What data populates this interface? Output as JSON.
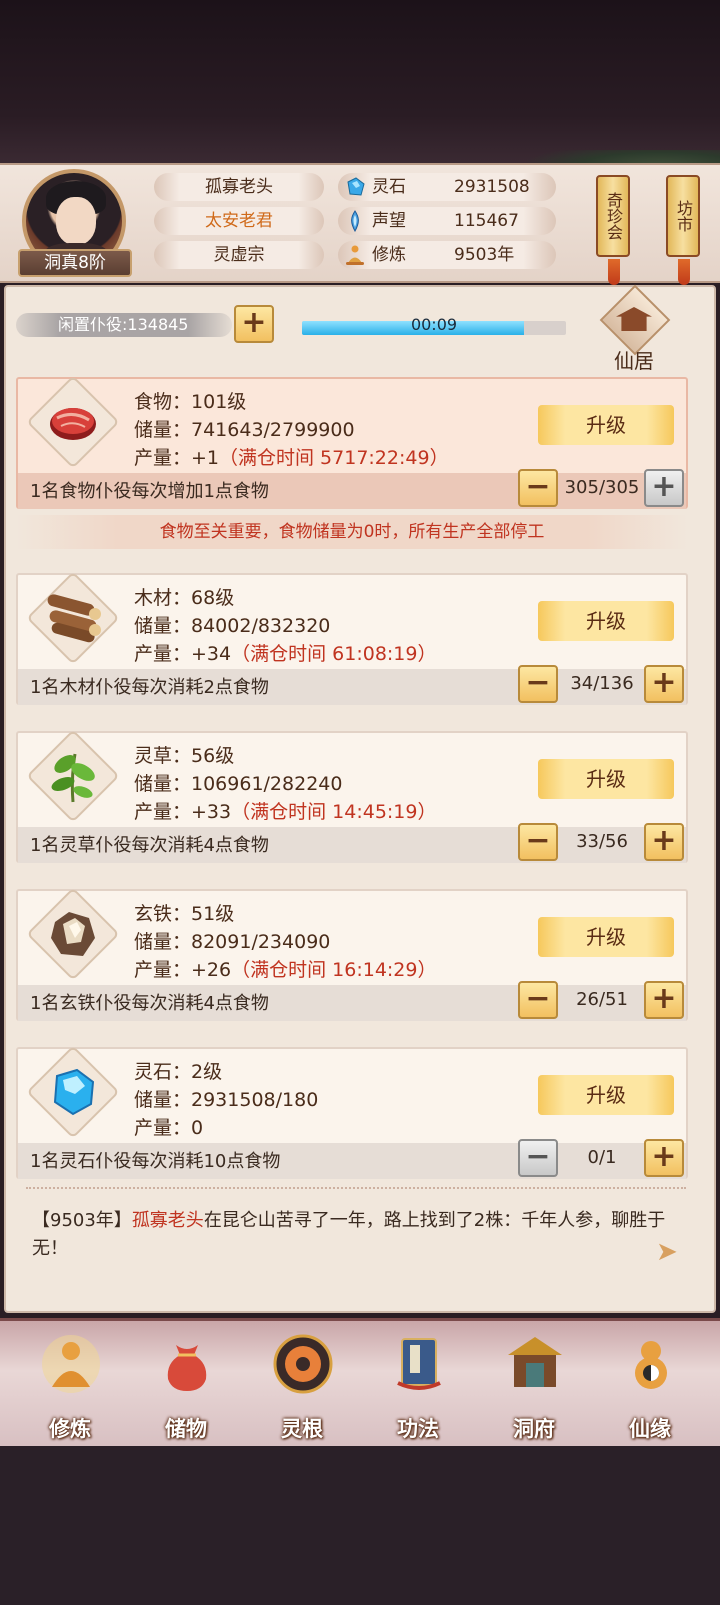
{
  "player": {
    "name": "孤寡老头",
    "title": "太安老君",
    "sect": "灵虚宗",
    "rank": "洞真8阶"
  },
  "stats": [
    {
      "icon": "spirit-stone-icon",
      "label": "灵石",
      "value": "2931508"
    },
    {
      "icon": "reputation-icon",
      "label": "声望",
      "value": "115467"
    },
    {
      "icon": "cultivation-icon",
      "label": "修炼",
      "value": "9503年"
    }
  ],
  "banners": {
    "treasure_label": "奇珍会",
    "market_label": "坊市"
  },
  "idle": {
    "label": "闲置仆役:",
    "count": "134845"
  },
  "timer": {
    "text": "00:09",
    "progress": 0.84
  },
  "residence_label": "仙居",
  "resources": [
    {
      "name": "食物",
      "level": "：101级",
      "storage": "储量：741643/2799900",
      "output": "产量：+1",
      "full": "（满仓时间 5717:22:49）",
      "desc": "1名食物仆役每次增加1点食物",
      "workers": "305/305",
      "upgrade": "升级",
      "icon": "meat-icon"
    },
    {
      "name": "木材",
      "level": "：68级",
      "storage": "储量：84002/832320",
      "output": "产量：+34",
      "full": "（满仓时间 61:08:19）",
      "desc": "1名木材仆役每次消耗2点食物",
      "workers": "34/136",
      "upgrade": "升级",
      "icon": "wood-icon"
    },
    {
      "name": "灵草",
      "level": "：56级",
      "storage": "储量：106961/282240",
      "output": "产量：+33",
      "full": "（满仓时间 14:45:19）",
      "desc": "1名灵草仆役每次消耗4点食物",
      "workers": "33/56",
      "upgrade": "升级",
      "icon": "herb-icon"
    },
    {
      "name": "玄铁",
      "level": "：51级",
      "storage": "储量：82091/234090",
      "output": "产量：+26",
      "full": "（满仓时间 16:14:29）",
      "desc": "1名玄铁仆役每次消耗4点食物",
      "workers": "26/51",
      "upgrade": "升级",
      "icon": "iron-ore-icon"
    },
    {
      "name": "灵石",
      "level": "：2级",
      "storage": "储量：2931508/180",
      "output": "产量：0",
      "full": "",
      "desc": "1名灵石仆役每次消耗10点食物",
      "workers": "0/1",
      "upgrade": "升级",
      "icon": "spirit-stone-icon"
    }
  ],
  "food_warning": "食物至关重要，食物储量为0时，所有生产全部停工",
  "log": {
    "year": "【9503年】",
    "name": "孤寡老头",
    "text": "在昆仑山苦寻了一年，路上找到了2株：千年人参，聊胜于无！"
  },
  "nav": [
    {
      "label": "修炼",
      "icon": "cultivation-icon"
    },
    {
      "label": "储物",
      "icon": "storage-bag-icon"
    },
    {
      "label": "灵根",
      "icon": "spirit-root-icon"
    },
    {
      "label": "功法",
      "icon": "technique-book-icon"
    },
    {
      "label": "洞府",
      "icon": "cave-mansion-icon"
    },
    {
      "label": "仙缘",
      "icon": "fortune-gourd-icon"
    }
  ]
}
